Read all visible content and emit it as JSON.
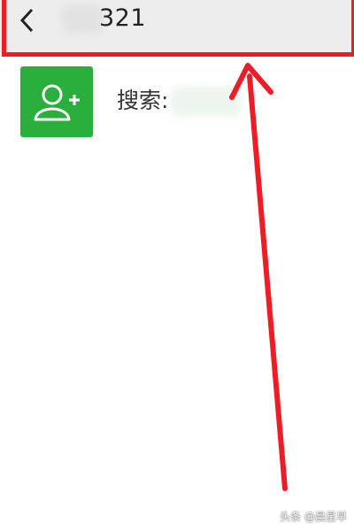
{
  "search_bar": {
    "back_icon": "chevron-left-icon",
    "query_visible": "321",
    "background_color": "#ededed"
  },
  "result": {
    "icon": "add-contact-icon",
    "icon_color": "#2aae3c",
    "label": "搜索:"
  },
  "annotation": {
    "color": "#ee1c25"
  },
  "watermark": {
    "text": "头条 @晨星早"
  }
}
